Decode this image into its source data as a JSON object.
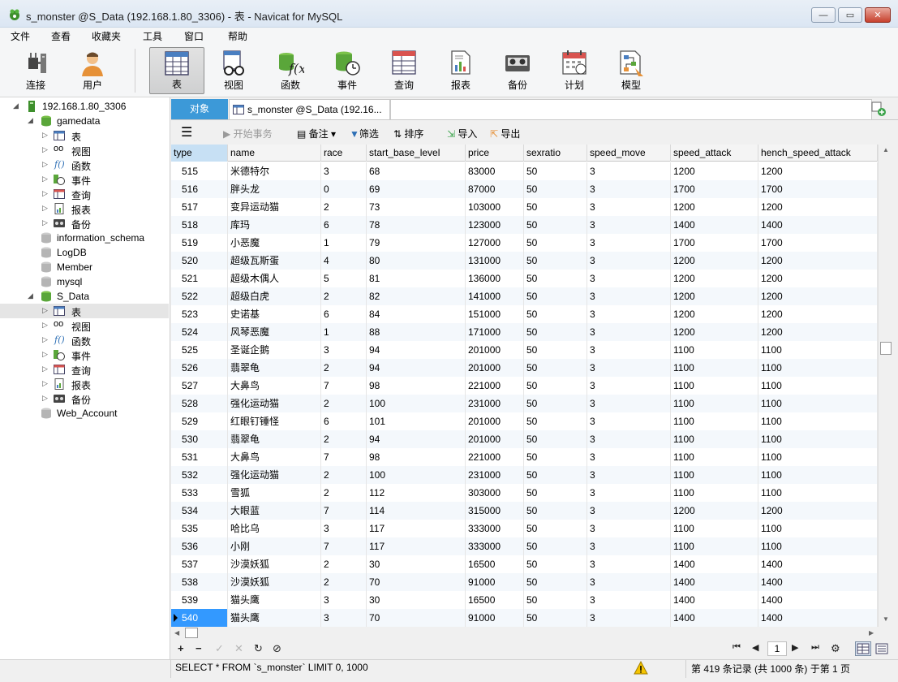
{
  "window": {
    "title": "s_monster @S_Data (192.168.1.80_3306) - 表 - Navicat for MySQL",
    "minimize_glyph": "—",
    "maximize_glyph": "▭",
    "close_glyph": "✕"
  },
  "menu": {
    "items": [
      "文件",
      "查看",
      "收藏夹",
      "工具",
      "窗口",
      "帮助"
    ]
  },
  "toolbar": {
    "items": [
      {
        "label": "连接",
        "icon": "plug-icon"
      },
      {
        "label": "用户",
        "icon": "user-icon"
      },
      {
        "label": "表",
        "icon": "table-icon",
        "active": true
      },
      {
        "label": "视图",
        "icon": "view-icon"
      },
      {
        "label": "函数",
        "icon": "function-icon"
      },
      {
        "label": "事件",
        "icon": "event-icon"
      },
      {
        "label": "查询",
        "icon": "query-icon"
      },
      {
        "label": "报表",
        "icon": "report-icon"
      },
      {
        "label": "备份",
        "icon": "backup-icon"
      },
      {
        "label": "计划",
        "icon": "schedule-icon"
      },
      {
        "label": "模型",
        "icon": "model-icon"
      }
    ]
  },
  "tree": {
    "connection": "192.168.1.80_3306",
    "gamedata": "gamedata",
    "gamedata_children": [
      "表",
      "视图",
      "函数",
      "事件",
      "查询",
      "报表",
      "备份"
    ],
    "other_dbs": [
      "information_schema",
      "LogDB",
      "Member",
      "mysql"
    ],
    "s_data": "S_Data",
    "s_data_children": [
      "表",
      "视图",
      "函数",
      "事件",
      "查询",
      "报表",
      "备份"
    ],
    "web_account": "Web_Account"
  },
  "tabs": {
    "objects": "对象",
    "table_tab": "s_monster @S_Data (192.16..."
  },
  "subtoolbar": {
    "menu_glyph": "☰",
    "begin_transaction": "开始事务",
    "memo": "备注",
    "filter": "筛选",
    "sort": "排序",
    "import": "导入",
    "export": "导出"
  },
  "grid": {
    "columns": [
      "type",
      "name",
      "race",
      "start_base_level",
      "price",
      "sexratio",
      "speed_move",
      "speed_attack",
      "hench_speed_attack"
    ],
    "rows": [
      [
        "515",
        "米德特尔",
        "3",
        "68",
        "83000",
        "50",
        "3",
        "1200",
        "1200"
      ],
      [
        "516",
        "胖头龙",
        "0",
        "69",
        "87000",
        "50",
        "3",
        "1700",
        "1700"
      ],
      [
        "517",
        "变异运动猫",
        "2",
        "73",
        "103000",
        "50",
        "3",
        "1200",
        "1200"
      ],
      [
        "518",
        "库玛",
        "6",
        "78",
        "123000",
        "50",
        "3",
        "1400",
        "1400"
      ],
      [
        "519",
        "小恶魔",
        "1",
        "79",
        "127000",
        "50",
        "3",
        "1700",
        "1700"
      ],
      [
        "520",
        "超级瓦斯蛋",
        "4",
        "80",
        "131000",
        "50",
        "3",
        "1200",
        "1200"
      ],
      [
        "521",
        "超级木偶人",
        "5",
        "81",
        "136000",
        "50",
        "3",
        "1200",
        "1200"
      ],
      [
        "522",
        "超级白虎",
        "2",
        "82",
        "141000",
        "50",
        "3",
        "1200",
        "1200"
      ],
      [
        "523",
        "史诺基",
        "6",
        "84",
        "151000",
        "50",
        "3",
        "1200",
        "1200"
      ],
      [
        "524",
        "风琴恶魔",
        "1",
        "88",
        "171000",
        "50",
        "3",
        "1200",
        "1200"
      ],
      [
        "525",
        "圣诞企鹅",
        "3",
        "94",
        "201000",
        "50",
        "3",
        "1100",
        "1100"
      ],
      [
        "526",
        "翡翠龟",
        "2",
        "94",
        "201000",
        "50",
        "3",
        "1100",
        "1100"
      ],
      [
        "527",
        "大鼻鸟",
        "7",
        "98",
        "221000",
        "50",
        "3",
        "1100",
        "1100"
      ],
      [
        "528",
        "强化运动猫",
        "2",
        "100",
        "231000",
        "50",
        "3",
        "1100",
        "1100"
      ],
      [
        "529",
        "红眼钉锤怪",
        "6",
        "101",
        "201000",
        "50",
        "3",
        "1100",
        "1100"
      ],
      [
        "530",
        "翡翠龟",
        "2",
        "94",
        "201000",
        "50",
        "3",
        "1100",
        "1100"
      ],
      [
        "531",
        "大鼻鸟",
        "7",
        "98",
        "221000",
        "50",
        "3",
        "1100",
        "1100"
      ],
      [
        "532",
        "强化运动猫",
        "2",
        "100",
        "231000",
        "50",
        "3",
        "1100",
        "1100"
      ],
      [
        "533",
        "雪狐",
        "2",
        "112",
        "303000",
        "50",
        "3",
        "1100",
        "1100"
      ],
      [
        "534",
        "大眼蓝",
        "7",
        "114",
        "315000",
        "50",
        "3",
        "1200",
        "1200"
      ],
      [
        "535",
        "哈比乌",
        "3",
        "117",
        "333000",
        "50",
        "3",
        "1100",
        "1100"
      ],
      [
        "536",
        "小刚",
        "7",
        "117",
        "333000",
        "50",
        "3",
        "1100",
        "1100"
      ],
      [
        "537",
        "沙漠妖狐",
        "2",
        "30",
        "16500",
        "50",
        "3",
        "1400",
        "1400"
      ],
      [
        "538",
        "沙漠妖狐",
        "2",
        "70",
        "91000",
        "50",
        "3",
        "1400",
        "1400"
      ],
      [
        "539",
        "猫头鹰",
        "3",
        "30",
        "16500",
        "50",
        "3",
        "1400",
        "1400"
      ],
      [
        "540",
        "猫头鹰",
        "3",
        "70",
        "91000",
        "50",
        "3",
        "1400",
        "1400"
      ]
    ],
    "selected_row": 25
  },
  "nav": {
    "page": "1",
    "add": "+",
    "remove": "−",
    "apply": "✓",
    "discard": "✕",
    "refresh": "↻",
    "stop": "⊘",
    "first": "⏮",
    "prev": "◀",
    "next": "▶",
    "last": "⏭",
    "settings": "⚙"
  },
  "status": {
    "sql": "SELECT * FROM `s_monster` LIMIT 0, 1000",
    "info": "第 419 条记录 (共 1000 条) 于第 1 页"
  },
  "colors": {
    "accent": "#3c99d8",
    "selection": "#3399ff"
  }
}
